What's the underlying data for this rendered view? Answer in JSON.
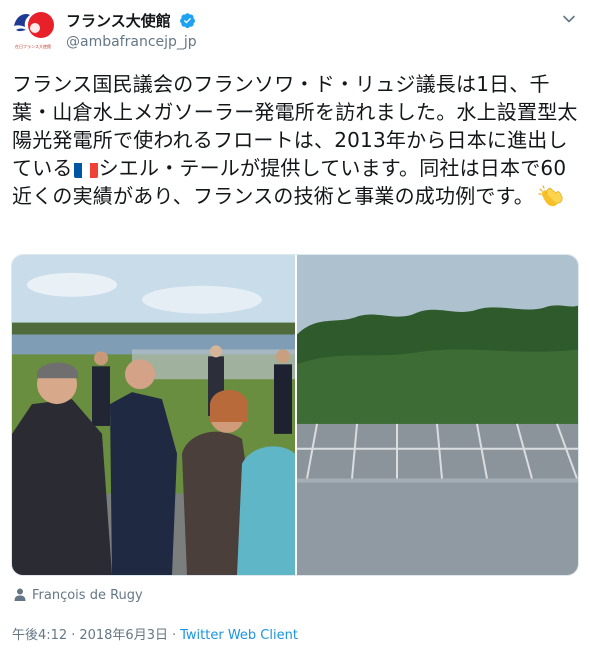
{
  "account": {
    "display_name": "フランス大使館",
    "handle": "@ambafrancejp_jp",
    "avatar_caption": "在日フランス大使館",
    "verified": true
  },
  "tweet": {
    "text_part1": "フランス国民議会のフランソワ・ド・リュジ議長は1日、千葉・山倉水上メガソーラー発電所を訪れました。水上設置型太陽光発電所で使われるフロートは、2013年から日本に進出している",
    "text_part2": "シエル・テールが提供しています。同社は日本で60近くの実績があり、フランスの技術と事業の成功例です。",
    "flag_icon": "france-flag-emoji",
    "clap_icon": "clapping-hands-emoji"
  },
  "media": {
    "count": 2,
    "photos": [
      {
        "name": "photo-delegation-visit",
        "desc_icon": "group-of-people-photo"
      },
      {
        "name": "photo-floating-solar-plant",
        "desc_icon": "solar-panels-on-water-photo"
      }
    ]
  },
  "tagged": {
    "icon": "person-icon",
    "name": "François de Rugy"
  },
  "meta": {
    "time": "午後4:12",
    "separator": "·",
    "date": "2018年6月3日",
    "source": "Twitter Web Client"
  },
  "colors": {
    "link": "#1b95e0",
    "secondary_text": "#657786",
    "verified": "#1da1f2",
    "flag_blue": "#0055a4",
    "flag_white": "#ffffff",
    "flag_red": "#ef4135"
  }
}
